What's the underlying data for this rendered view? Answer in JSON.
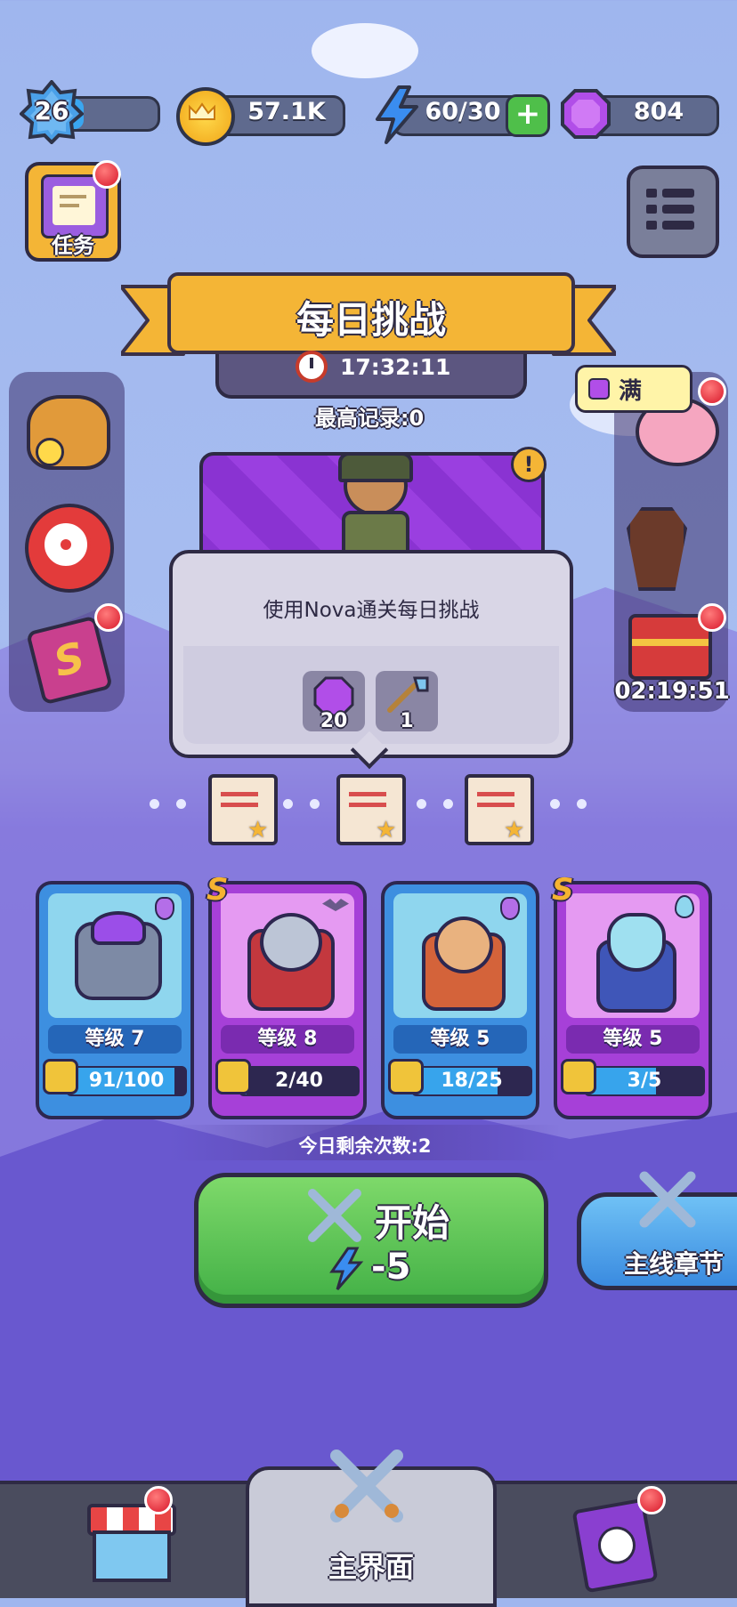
{
  "top_bar": {
    "level": "26",
    "level_progress": 0.2,
    "coins": "57.1K",
    "energy": "60/30",
    "gems": "804"
  },
  "tasks_button": {
    "label": "任务"
  },
  "banner": {
    "title": "每日挑战",
    "timer": "17:32:11",
    "best_record": "最高记录:0"
  },
  "piggy": {
    "label": "满"
  },
  "chest_timer": "02:19:51",
  "tooltip": {
    "text": "使用Nova通关每日挑战",
    "rewards": [
      {
        "icon": "gem-icon",
        "count": "20"
      },
      {
        "icon": "key-icon",
        "count": "1"
      }
    ]
  },
  "heroes": [
    {
      "rarity": "",
      "level": "等级 7",
      "progress": "91/100",
      "fill": 0.91,
      "color": "blue"
    },
    {
      "rarity": "S",
      "level": "等级 8",
      "progress": "2/40",
      "fill": 0.05,
      "color": "purple"
    },
    {
      "rarity": "",
      "level": "等级 5",
      "progress": "18/25",
      "fill": 0.72,
      "color": "blue"
    },
    {
      "rarity": "S",
      "level": "等级 5",
      "progress": "3/5",
      "fill": 0.6,
      "color": "purple"
    }
  ],
  "remaining": "今日剩余次数:2",
  "start_button": {
    "label": "开始",
    "cost": "-5"
  },
  "main_chapter_button": {
    "label": "主线章节"
  },
  "bottom_nav": {
    "home_label": "主界面"
  },
  "colors": {
    "gold": "#f4b536",
    "green": "#4cbb4a",
    "purple": "#9a3fe0",
    "blue": "#37a4ec"
  }
}
